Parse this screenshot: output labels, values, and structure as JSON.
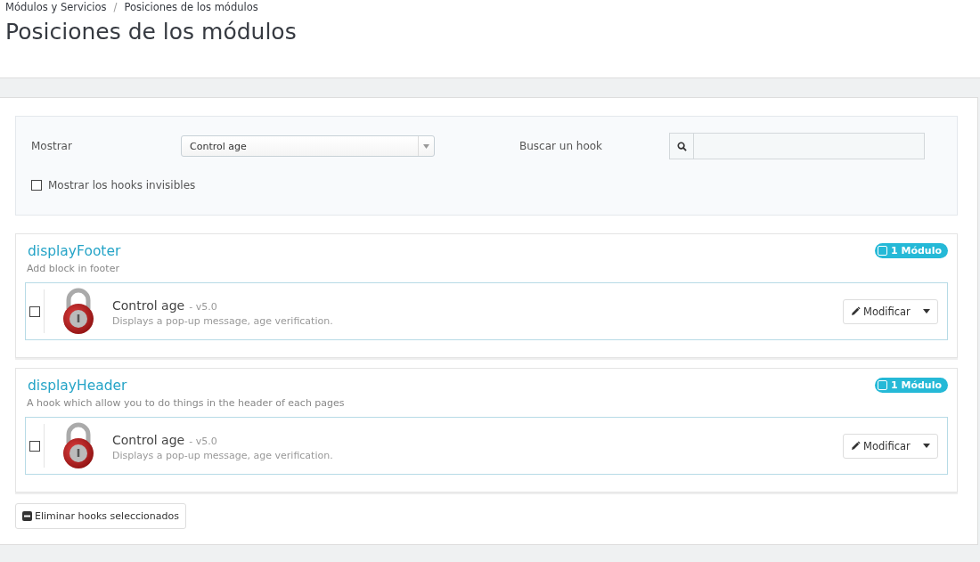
{
  "breadcrumb": [
    "Módulos y Servicios",
    "Posiciones de los módulos"
  ],
  "breadcrumb_separator": "/",
  "page_title": "Posiciones de los módulos",
  "filters": {
    "show_label": "Mostrar",
    "show_value": "Control age",
    "search_label": "Buscar un hook",
    "invisible_hooks": {
      "label": "Mostrar los hooks invisibles",
      "checked": false
    }
  },
  "hooks": [
    {
      "name": "displayFooter",
      "description": "Add block in footer",
      "badge": "1 Módulo",
      "checked": false,
      "modules": [
        {
          "name": "Control age",
          "version": "- v5.0",
          "description": "Displays a pop-up message, age verification.",
          "checked": false,
          "action": "Modificar"
        }
      ]
    },
    {
      "name": "displayHeader",
      "description": "A hook which allow you to do things in the header of each pages",
      "badge": "1 Módulo",
      "checked": false,
      "modules": [
        {
          "name": "Control age",
          "version": "- v5.0",
          "description": "Displays a pop-up message, age verification.",
          "checked": false,
          "action": "Modificar"
        }
      ]
    }
  ],
  "delete_button": "Eliminar hooks seleccionados"
}
